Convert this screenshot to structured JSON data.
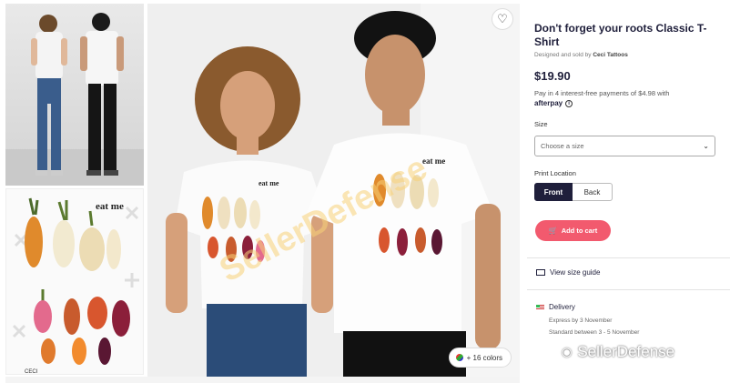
{
  "product": {
    "title": "Don't forget your roots Classic T-Shirt",
    "designed_prefix": "Designed and sold by",
    "designer": "Ceci Tattoos",
    "price": "$19.90",
    "pay_text": "Pay in 4 interest-free payments of $4.98 with",
    "afterpay": "afterpay",
    "size_label": "Size",
    "size_placeholder": "Choose a size",
    "print_location_label": "Print Location",
    "print_front": "Front",
    "print_back": "Back",
    "add_to_cart": "Add to cart",
    "size_guide": "View size guide",
    "delivery_title": "Delivery",
    "delivery_express": "Express by 3 November",
    "delivery_standard": "Standard between 3 - 5 November"
  },
  "gallery": {
    "colors_badge": "+ 16 colors",
    "shirt_text": "eat me",
    "thumb_signature": "CECI"
  },
  "watermark": {
    "brand": "SellerDefense",
    "overlay": "SellerDefense"
  },
  "colors": {
    "accent": "#f25a6e",
    "navy": "#1f1f3b"
  }
}
